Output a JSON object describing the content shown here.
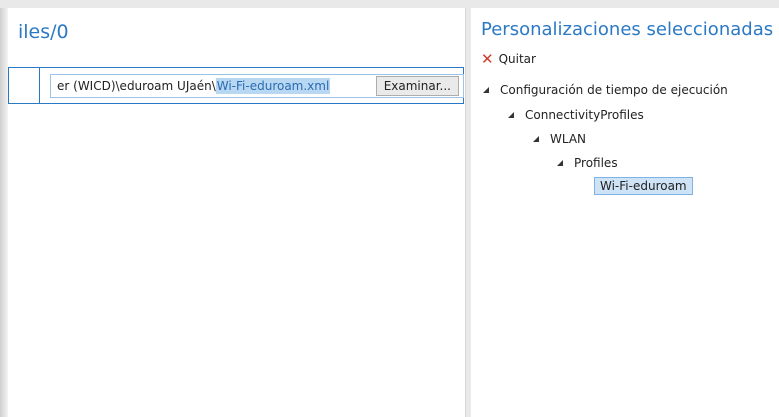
{
  "left": {
    "title": "iles/0",
    "path_text": "er (WICD)\\eduroam UJaén\\",
    "path_selected": "Wi-Fi-eduroam.xml",
    "browse_label": "Examinar..."
  },
  "right": {
    "title": "Personalizaciones seleccionadas",
    "remove_label": "Quitar",
    "tree": {
      "root": "Configuración de tiempo de ejecución",
      "level1": "ConnectivityProfiles",
      "level2": "WLAN",
      "level3": "Profiles",
      "leaf": "Wi-Fi-eduroam"
    }
  },
  "colors": {
    "accent": "#2b79c4",
    "selection": "#cfe3f7",
    "remove": "#d43b2d"
  },
  "icons": {
    "remove": "close-icon",
    "expand": "expanded-triangle-icon"
  }
}
